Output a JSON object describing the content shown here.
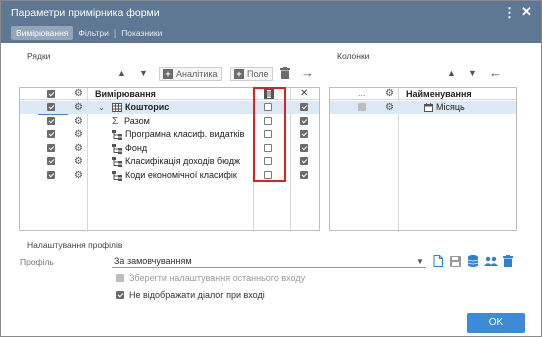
{
  "dialog": {
    "title": "Параметри примірника форми",
    "tabs": [
      {
        "label": "Вимірювання",
        "active": true
      },
      {
        "label": "Фільтри",
        "active": false
      },
      {
        "label": "Показники",
        "active": false
      }
    ],
    "accent_color": "#5e7894"
  },
  "rows_section": {
    "label": "Рядки",
    "toolbar": {
      "analytics_label": "Аналітика",
      "field_label": "Поле"
    },
    "header": {
      "name_label": "Вимірювання",
      "clear_label": "✕"
    },
    "items": [
      {
        "name": "Кошторис",
        "icon": "table-icon",
        "level": 0,
        "bold": true,
        "expanded": true,
        "checked": true,
        "flag": false,
        "visible": true
      },
      {
        "name": "Разом",
        "icon": "sigma-icon",
        "level": 1,
        "bold": false,
        "checked": true,
        "flag": false,
        "visible": true
      },
      {
        "name": "Програмна класиф. видатків",
        "icon": "hierarchy-icon",
        "level": 1,
        "bold": false,
        "checked": true,
        "flag": false,
        "visible": true
      },
      {
        "name": "Фонд",
        "icon": "hierarchy-icon",
        "level": 1,
        "bold": false,
        "checked": true,
        "flag": false,
        "visible": true
      },
      {
        "name": "Класифікація доходів бюдж",
        "icon": "hierarchy-icon",
        "level": 1,
        "bold": false,
        "checked": true,
        "flag": false,
        "visible": true
      },
      {
        "name": "Коди економічної класифік",
        "icon": "hierarchy-icon",
        "level": 1,
        "bold": false,
        "checked": true,
        "flag": false,
        "visible": true
      }
    ]
  },
  "columns_section": {
    "label": "Колонки",
    "header": {
      "dots": "...",
      "name_label": "Найменування"
    },
    "items": [
      {
        "name": "Місяць",
        "icon": "calendar-icon",
        "checked": true
      }
    ]
  },
  "profiles": {
    "section_label": "Налаштування профілів",
    "profile_label": "Профіль",
    "profile_value": "За замовчуванням",
    "save_last_label": "Зберегти налаштування останнього входу",
    "save_last_checked": true,
    "save_last_disabled": true,
    "hide_dialog_label": "Не відображати діалог при вході",
    "hide_dialog_checked": true
  },
  "ok_label": "OK"
}
